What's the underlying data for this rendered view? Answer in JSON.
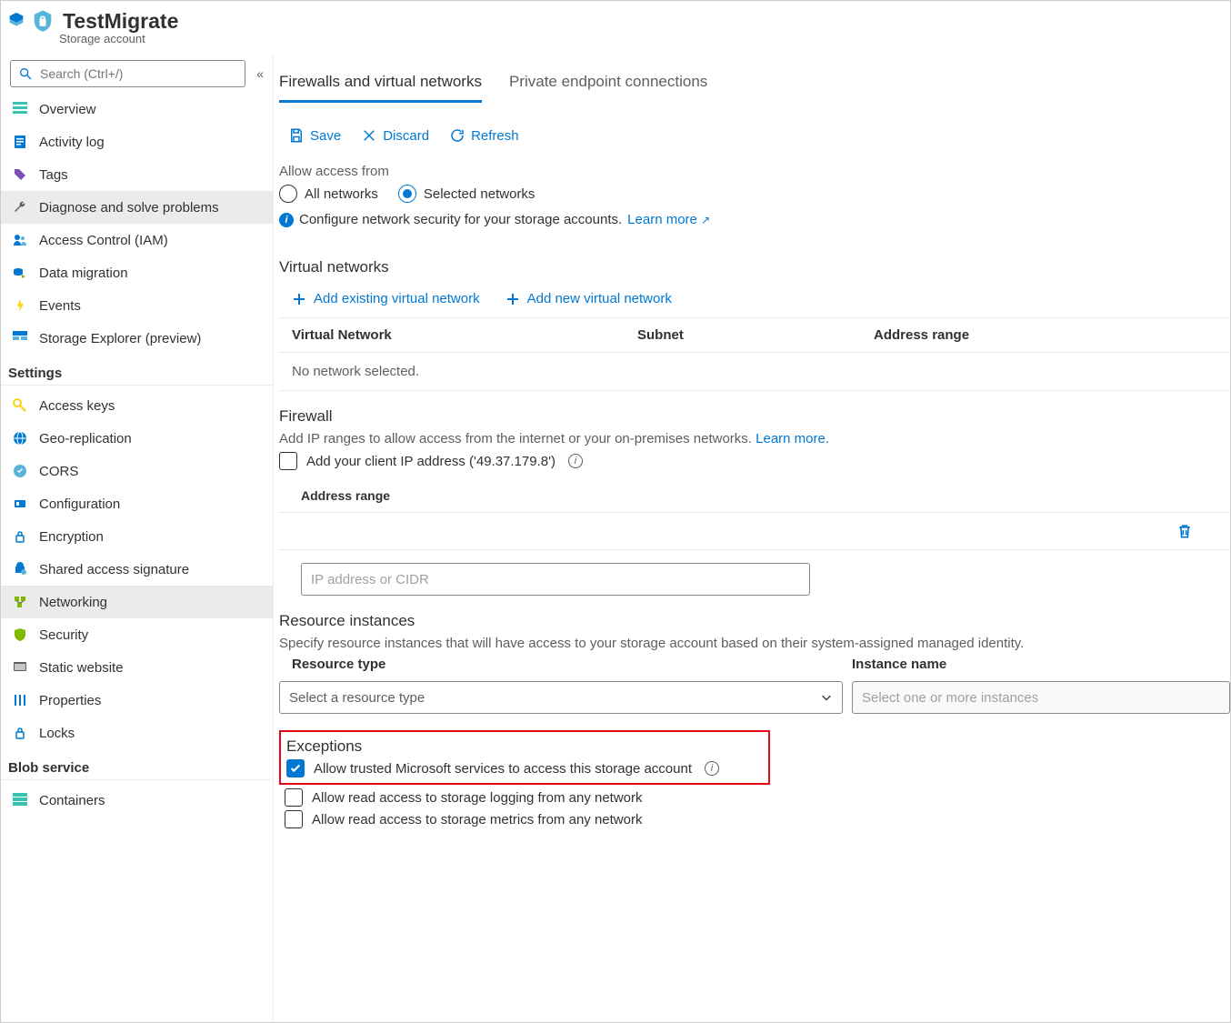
{
  "header": {
    "title": "TestMigrate",
    "subtitle": "Storage account"
  },
  "search": {
    "placeholder": "Search (Ctrl+/)"
  },
  "sidebar": {
    "items": [
      {
        "label": "Overview"
      },
      {
        "label": "Activity log"
      },
      {
        "label": "Tags"
      },
      {
        "label": "Diagnose and solve problems"
      },
      {
        "label": "Access Control (IAM)"
      },
      {
        "label": "Data migration"
      },
      {
        "label": "Events"
      },
      {
        "label": "Storage Explorer (preview)"
      }
    ],
    "groups": {
      "settings": "Settings",
      "blob": "Blob service"
    },
    "settings_items": [
      {
        "label": "Access keys"
      },
      {
        "label": "Geo-replication"
      },
      {
        "label": "CORS"
      },
      {
        "label": "Configuration"
      },
      {
        "label": "Encryption"
      },
      {
        "label": "Shared access signature"
      },
      {
        "label": "Networking"
      },
      {
        "label": "Security"
      },
      {
        "label": "Static website"
      },
      {
        "label": "Properties"
      },
      {
        "label": "Locks"
      }
    ],
    "blob_items": [
      {
        "label": "Containers"
      }
    ]
  },
  "tabs": {
    "firewalls": "Firewalls and virtual networks",
    "private": "Private endpoint connections"
  },
  "toolbar": {
    "save": "Save",
    "discard": "Discard",
    "refresh": "Refresh"
  },
  "access": {
    "label": "Allow access from",
    "all": "All networks",
    "selected": "Selected networks",
    "info_text": "Configure network security for your storage accounts.",
    "learn_more": "Learn more"
  },
  "vnet": {
    "title": "Virtual networks",
    "add_existing": "Add existing virtual network",
    "add_new": "Add new virtual network",
    "col_vn": "Virtual Network",
    "col_sub": "Subnet",
    "col_addr": "Address range",
    "empty": "No network selected."
  },
  "firewall": {
    "title": "Firewall",
    "desc": "Add IP ranges to allow access from the internet or your on-premises networks.",
    "learn_more": "Learn more.",
    "client_ip_label": "Add your client IP address ('49.37.179.8')",
    "addr_header": "Address range",
    "input_placeholder": "IP address or CIDR"
  },
  "ri": {
    "title": "Resource instances",
    "desc": "Specify resource instances that will have access to your storage account based on their system-assigned managed identity.",
    "col_type": "Resource type",
    "col_name": "Instance name",
    "type_placeholder": "Select a resource type",
    "name_placeholder": "Select one or more instances"
  },
  "ex": {
    "title": "Exceptions",
    "opt1": "Allow trusted Microsoft services to access this storage account",
    "opt2": "Allow read access to storage logging from any network",
    "opt3": "Allow read access to storage metrics from any network"
  }
}
